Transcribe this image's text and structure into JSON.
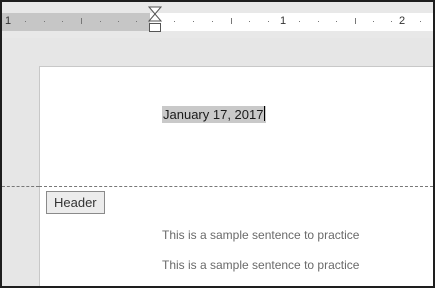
{
  "ruler": {
    "numbers": [
      "1",
      "1",
      "2"
    ]
  },
  "document": {
    "date_field": "January 17, 2017",
    "header_label": "Header",
    "body_lines": [
      "This is a sample sentence to practice",
      "This is a sample sentence to practice"
    ]
  },
  "colors": {
    "ruler_margin": "#c6c6c6",
    "selection": "#c9c9c9",
    "frame_border": "#1e1e1e"
  }
}
